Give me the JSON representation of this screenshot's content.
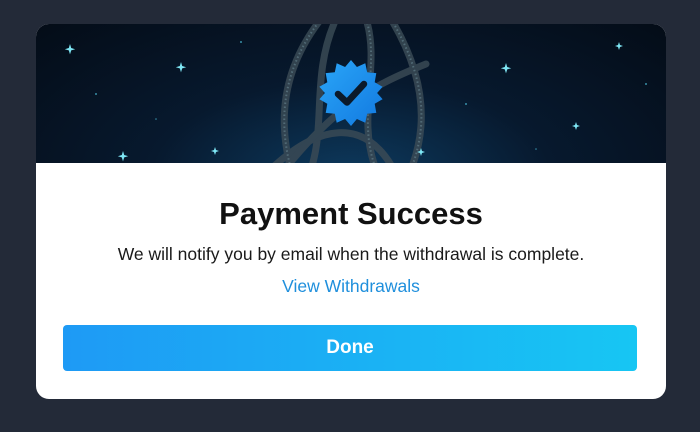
{
  "dialog": {
    "title": "Payment Success",
    "message": "We will notify you by email when the withdrawal is complete.",
    "link_label": "View Withdrawals",
    "primary_button_label": "Done",
    "badge_icon": "verified-check-badge-icon"
  },
  "colors": {
    "page_background": "#232a38",
    "hero_dark": "#040c17",
    "hero_glow": "#0d3a5e",
    "badge_blue": "#1e9af5",
    "link_blue": "#1f8fdc",
    "button_gradient_start": "#1e9af5",
    "button_gradient_end": "#17c6f3"
  }
}
